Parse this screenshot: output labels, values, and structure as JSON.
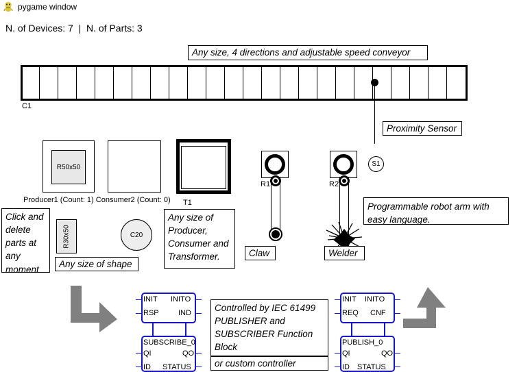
{
  "window": {
    "title": "pygame window",
    "icon": "pygame-snake-icon"
  },
  "status": {
    "text": "N. of Devices: 7  |  N. of Parts: 3",
    "devices": 7,
    "parts": 3
  },
  "callouts": {
    "conveyor": "Any size, 4 directions and adjustable speed conveyor",
    "proximity": "Proximity Sensor",
    "click_delete": "Click and delete parts at any moment",
    "shape": "Any size of shape",
    "producer_consumer_transformer": "Any size of Producer, Consumer and Transformer.",
    "robot_arm": "Programmable robot arm with easy language.",
    "claw": "Claw",
    "welder": "Welder",
    "iec": "Controlled by IEC 61499 PUBLISHER and SUBSCRIBER Function Block",
    "custom_controller": "or custom controller"
  },
  "conveyor": {
    "label": "C1",
    "segments": 24
  },
  "sensor": {
    "label": "S1"
  },
  "devices": {
    "producer": {
      "caption": "Producer1 (Count: 1)",
      "part_label": "R50x50"
    },
    "consumer": {
      "caption": "Consumer2 (Count: 0)"
    },
    "transformer": {
      "label": "T1"
    },
    "robot1": {
      "label": "R1"
    },
    "robot2": {
      "label": "R2"
    }
  },
  "parts": {
    "rect": "R30x50",
    "circle": "C20"
  },
  "function_blocks": {
    "subscriber": {
      "name": "SUBSCRIBE_0",
      "top_left": [
        "INIT",
        "RSP"
      ],
      "top_right": [
        "INITO",
        "IND"
      ],
      "bottom_left": [
        "QI",
        "ID"
      ],
      "bottom_right": [
        "QO",
        "STATUS"
      ]
    },
    "publisher": {
      "name": "PUBLISH_0",
      "top_left": [
        "INIT",
        "REQ"
      ],
      "top_right": [
        "INITO",
        "CNF"
      ],
      "bottom_left": [
        "QI",
        "ID"
      ],
      "bottom_right": [
        "QO",
        "STATUS"
      ]
    }
  },
  "arrows": {
    "left": "arrow-down-right",
    "right": "arrow-up-left"
  },
  "colors": {
    "fb_blue": "#1616c8",
    "arrow_gray": "#808080",
    "part_fill": "#e8e8e8",
    "outline": "#000000"
  }
}
